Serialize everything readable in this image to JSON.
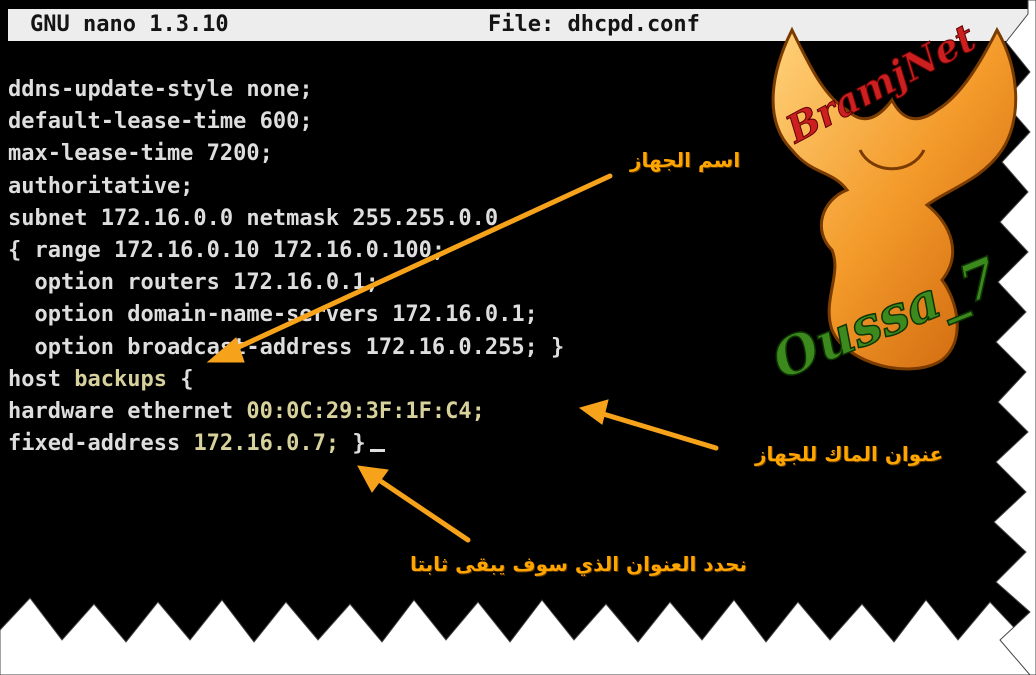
{
  "window": {
    "app_title": "GNU nano 1.3.10",
    "file_title": "File: dhcpd.conf"
  },
  "editor": {
    "lines": [
      {
        "text": "ddns-update-style none;"
      },
      {
        "text": "default-lease-time 600;"
      },
      {
        "text": "max-lease-time 7200;"
      },
      {
        "text": "authoritative;"
      },
      {
        "text": "subnet 172.16.0.0 netmask 255.255.0.0"
      },
      {
        "text": "{ range 172.16.0.10 172.16.0.100;"
      },
      {
        "text": "  option routers 172.16.0.1;"
      },
      {
        "text": "  option domain-name-servers 172.16.0.1;"
      },
      {
        "text": "  option broadcast-address 172.16.0.255; }"
      },
      {
        "prefix": "host ",
        "highlight": "backups",
        "suffix": " {"
      },
      {
        "prefix": "hardware ethernet ",
        "highlight": "00:0C:29:3F:1F:C4;",
        "suffix": ""
      },
      {
        "prefix": "fixed-address ",
        "highlight": "172.16.0.7;",
        "suffix": " }"
      }
    ]
  },
  "annotations": {
    "device_name": "اسم الجهاز",
    "mac_address": "عنوان الماك للجهاز",
    "fixed_address": "نحدد العنوان الذي سوف يبقى ثابتا"
  },
  "watermark": {
    "brand": "BramjNet",
    "author": "Oussa_7"
  },
  "colors": {
    "terminal_bg": "#000000",
    "terminal_text": "#dedede",
    "highlight_text": "#d7d19b",
    "titlebar_bg": "#ededed",
    "arrow": "#f7a21b",
    "logo_orange": "#f08c1e",
    "brand_red": "#cc1f1f",
    "author_green": "#3c8a1e"
  }
}
